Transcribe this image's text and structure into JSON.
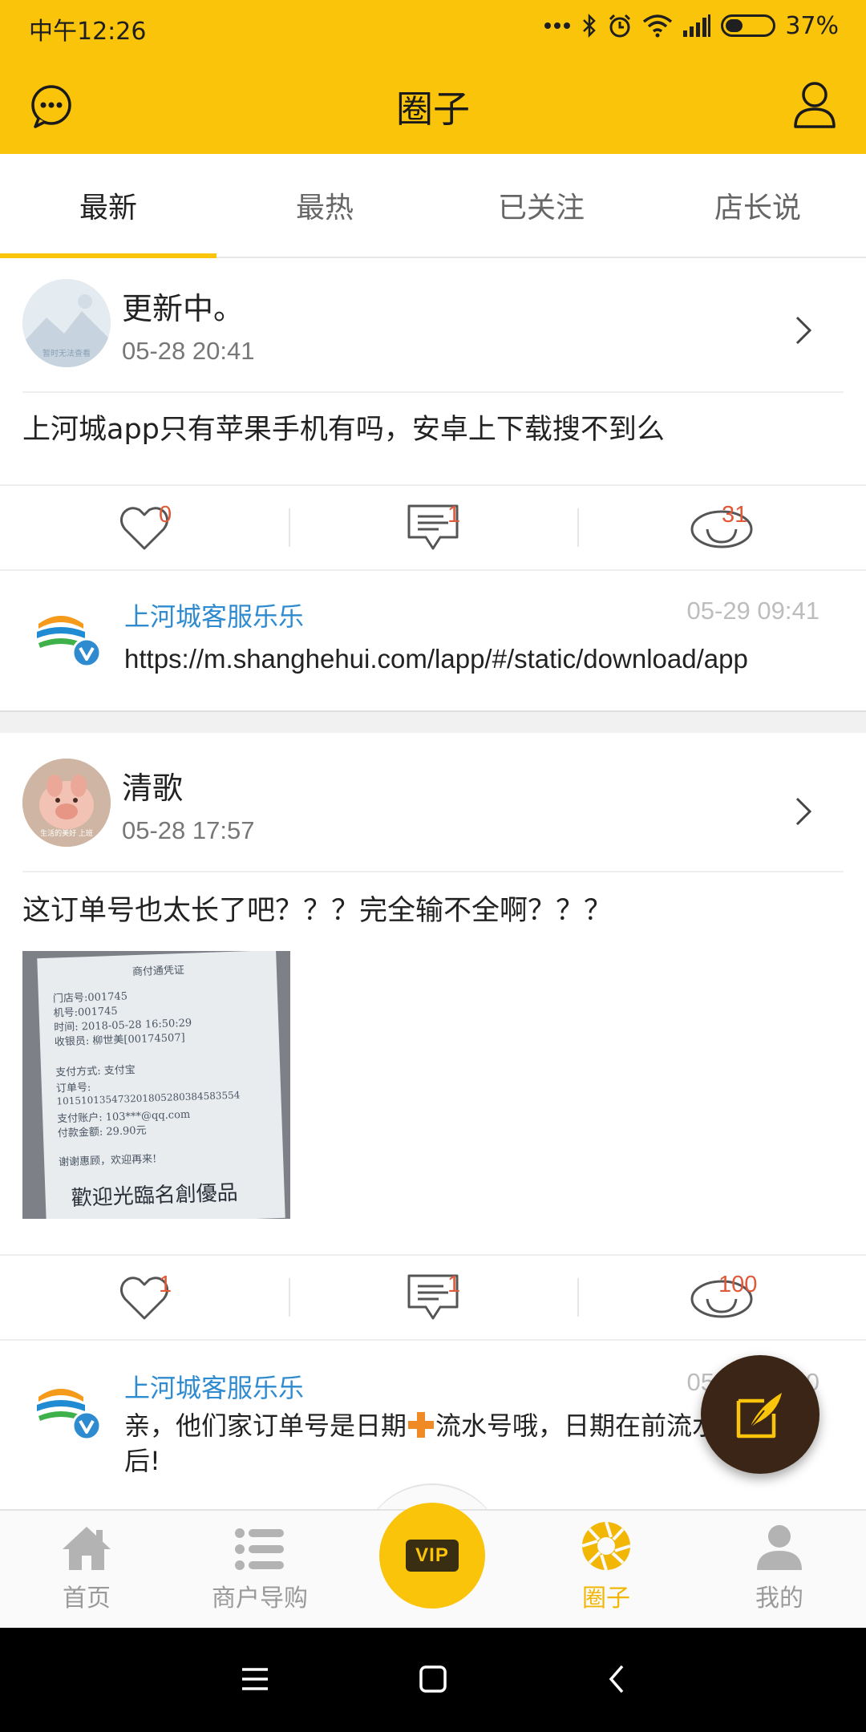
{
  "status_bar": {
    "time": "中午12:26",
    "battery": "37%",
    "battery_level": 0.37
  },
  "header": {
    "title": "圈子"
  },
  "tabs": [
    {
      "label": "最新",
      "active": true
    },
    {
      "label": "最热",
      "active": false
    },
    {
      "label": "已关注",
      "active": false
    },
    {
      "label": "店长说",
      "active": false
    }
  ],
  "posts": [
    {
      "author": "更新中。",
      "avatar_caption": "暂时无法查看",
      "time": "05-28 20:41",
      "content": "上河城app只有苹果手机有吗，安卓上下载搜不到么",
      "likes": "0",
      "comments": "1",
      "views": "31",
      "reply": {
        "name": "上河城客服乐乐",
        "time": "05-29 09:41",
        "text": "https://m.shanghehui.com/lapp/#/static/download/app"
      }
    },
    {
      "author": "清歌",
      "avatar_caption": "生活的美好 上班",
      "time": "05-28 17:57",
      "content": "这订单号也太长了吧？？？完全输不全啊？？？",
      "likes": "1",
      "comments": "1",
      "views": "100",
      "receipt": {
        "title": "商付通凭证",
        "lines": [
          "门店号:001745",
          "机号:001745",
          "时间:        2018-05-28  16:50:29",
          "收银员: 柳世美[00174507]",
          "支付方式:                    支付宝",
          "订单号:",
          "10151013547320180528038458355​4",
          "支付账户: 103***@qq.com",
          "付款金额:                   29.90元",
          "谢谢惠顾，欢迎再来!"
        ],
        "footer": "歡迎光臨名創優品"
      },
      "reply": {
        "name": "上河城客服乐乐",
        "time": "05-29 09:40",
        "text_before": "亲，他们家订单号是日期",
        "text_after": "流水号哦，日期在前流水",
        "text_line2": "后!"
      }
    }
  ],
  "bottom_nav": [
    {
      "label": "首页",
      "icon": "home-icon",
      "active": false
    },
    {
      "label": "商户导购",
      "icon": "list-icon",
      "active": false
    },
    {
      "label": "VIP",
      "icon": "vip-icon",
      "active": false
    },
    {
      "label": "圈子",
      "icon": "aperture-icon",
      "active": true
    },
    {
      "label": "我的",
      "icon": "person-icon",
      "active": false
    }
  ],
  "colors": {
    "brand": "#fac40a",
    "reply_name": "#2f8bd0",
    "count": "#e05a3a",
    "fab": "#3b2516"
  }
}
